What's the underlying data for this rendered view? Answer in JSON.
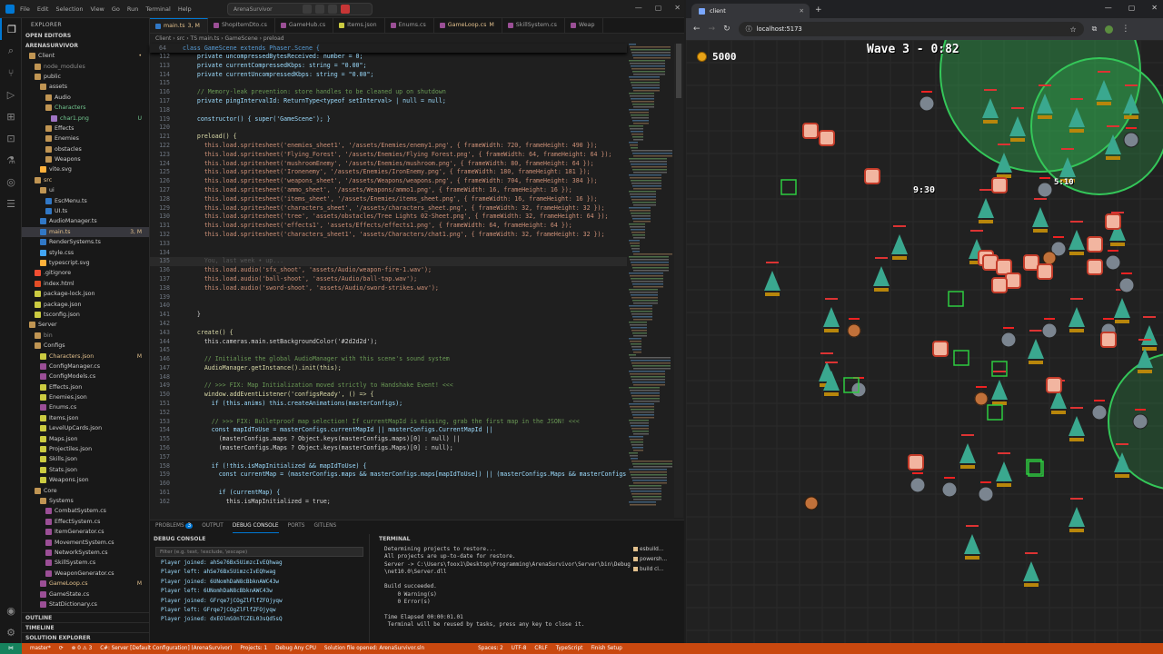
{
  "vscode": {
    "menu": [
      "File",
      "Edit",
      "Selection",
      "View",
      "Go",
      "Run",
      "Terminal",
      "Help"
    ],
    "search": "ArenaSurvivor",
    "explorer_title": "EXPLORER",
    "open_editors": "OPEN EDITORS",
    "workspace": "ARENASURVIVOR",
    "tree": [
      {
        "label": "Client",
        "indent": 1,
        "color": "#cccccc",
        "icon": "folder",
        "badge": "•",
        "bc": "#e2c08d"
      },
      {
        "label": "node_modules",
        "indent": 2,
        "color": "#8b8b8b",
        "icon": "folder"
      },
      {
        "label": "public",
        "indent": 2,
        "color": "#cccccc",
        "icon": "folder"
      },
      {
        "label": "assets",
        "indent": 3,
        "color": "#cccccc",
        "icon": "folder"
      },
      {
        "label": "Audio",
        "indent": 4,
        "color": "#cccccc",
        "icon": "folder"
      },
      {
        "label": "Characters",
        "indent": 4,
        "color": "#73c991",
        "icon": "folder"
      },
      {
        "label": "char1.png",
        "indent": 5,
        "color": "#73c991",
        "icon": "img",
        "badge": "U",
        "bc": "#73c991"
      },
      {
        "label": "Effects",
        "indent": 4,
        "color": "#cccccc",
        "icon": "folder"
      },
      {
        "label": "Enemies",
        "indent": 4,
        "color": "#cccccc",
        "icon": "folder"
      },
      {
        "label": "obstacles",
        "indent": 4,
        "color": "#cccccc",
        "icon": "folder"
      },
      {
        "label": "Weapons",
        "indent": 4,
        "color": "#cccccc",
        "icon": "folder"
      },
      {
        "label": "vite.svg",
        "indent": 3,
        "color": "#cccccc",
        "icon": "svg"
      },
      {
        "label": "src",
        "indent": 2,
        "color": "#e2c08d",
        "icon": "folder"
      },
      {
        "label": "ui",
        "indent": 3,
        "color": "#cccccc",
        "icon": "folder"
      },
      {
        "label": "EscMenu.ts",
        "indent": 4,
        "color": "#cccccc",
        "icon": "ts"
      },
      {
        "label": "UI.ts",
        "indent": 4,
        "color": "#cccccc",
        "icon": "ts"
      },
      {
        "label": "AudioManager.ts",
        "indent": 3,
        "color": "#cccccc",
        "icon": "ts"
      },
      {
        "label": "main.ts",
        "indent": 3,
        "color": "#e2c08d",
        "icon": "ts",
        "badge": "3, M",
        "bc": "#e2c08d",
        "sel": true
      },
      {
        "label": "RenderSystems.ts",
        "indent": 3,
        "color": "#cccccc",
        "icon": "ts"
      },
      {
        "label": "style.css",
        "indent": 3,
        "color": "#cccccc",
        "icon": "css"
      },
      {
        "label": "typescript.svg",
        "indent": 3,
        "color": "#cccccc",
        "icon": "svg"
      },
      {
        "label": ".gitignore",
        "indent": 2,
        "color": "#cccccc",
        "icon": "git"
      },
      {
        "label": "index.html",
        "indent": 2,
        "color": "#cccccc",
        "icon": "html"
      },
      {
        "label": "package-lock.json",
        "indent": 2,
        "color": "#cccccc",
        "icon": "json"
      },
      {
        "label": "package.json",
        "indent": 2,
        "color": "#cccccc",
        "icon": "json"
      },
      {
        "label": "tsconfig.json",
        "indent": 2,
        "color": "#cccccc",
        "icon": "json"
      },
      {
        "label": "Server",
        "indent": 1,
        "color": "#cccccc",
        "icon": "folder"
      },
      {
        "label": "bin",
        "indent": 2,
        "color": "#8b8b8b",
        "icon": "folder"
      },
      {
        "label": "Configs",
        "indent": 2,
        "color": "#cccccc",
        "icon": "folder"
      },
      {
        "label": "Characters.json",
        "indent": 3,
        "color": "#e2c08d",
        "icon": "json",
        "badge": "M",
        "bc": "#e2c08d"
      },
      {
        "label": "ConfigManager.cs",
        "indent": 3,
        "color": "#cccccc",
        "icon": "cs"
      },
      {
        "label": "ConfigModels.cs",
        "indent": 3,
        "color": "#cccccc",
        "icon": "cs"
      },
      {
        "label": "Effects.json",
        "indent": 3,
        "color": "#cccccc",
        "icon": "json"
      },
      {
        "label": "Enemies.json",
        "indent": 3,
        "color": "#cccccc",
        "icon": "json"
      },
      {
        "label": "Enums.cs",
        "indent": 3,
        "color": "#cccccc",
        "icon": "cs"
      },
      {
        "label": "Items.json",
        "indent": 3,
        "color": "#cccccc",
        "icon": "json"
      },
      {
        "label": "LevelUpCards.json",
        "indent": 3,
        "color": "#cccccc",
        "icon": "json"
      },
      {
        "label": "Maps.json",
        "indent": 3,
        "color": "#cccccc",
        "icon": "json"
      },
      {
        "label": "Projectiles.json",
        "indent": 3,
        "color": "#cccccc",
        "icon": "json"
      },
      {
        "label": "Skills.json",
        "indent": 3,
        "color": "#cccccc",
        "icon": "json"
      },
      {
        "label": "Stats.json",
        "indent": 3,
        "color": "#cccccc",
        "icon": "json"
      },
      {
        "label": "Weapons.json",
        "indent": 3,
        "color": "#cccccc",
        "icon": "json"
      },
      {
        "label": "Core",
        "indent": 2,
        "color": "#cccccc",
        "icon": "folder"
      },
      {
        "label": "Systems",
        "indent": 3,
        "color": "#cccccc",
        "icon": "folder"
      },
      {
        "label": "CombatSystem.cs",
        "indent": 4,
        "color": "#cccccc",
        "icon": "cs"
      },
      {
        "label": "EffectSystem.cs",
        "indent": 4,
        "color": "#cccccc",
        "icon": "cs"
      },
      {
        "label": "ItemGenerator.cs",
        "indent": 4,
        "color": "#cccccc",
        "icon": "cs"
      },
      {
        "label": "MovementSystem.cs",
        "indent": 4,
        "color": "#cccccc",
        "icon": "cs"
      },
      {
        "label": "NetworkSystem.cs",
        "indent": 4,
        "color": "#cccccc",
        "icon": "cs"
      },
      {
        "label": "SkillSystem.cs",
        "indent": 4,
        "color": "#cccccc",
        "icon": "cs"
      },
      {
        "label": "WeaponGenerator.cs",
        "indent": 4,
        "color": "#cccccc",
        "icon": "cs"
      },
      {
        "label": "GameLoop.cs",
        "indent": 3,
        "color": "#e2c08d",
        "icon": "cs",
        "badge": "M",
        "bc": "#e2c08d"
      },
      {
        "label": "GameState.cs",
        "indent": 3,
        "color": "#cccccc",
        "icon": "cs"
      },
      {
        "label": "StatDictionary.cs",
        "indent": 3,
        "color": "#cccccc",
        "icon": "cs"
      }
    ],
    "outline": "OUTLINE",
    "timeline": "TIMELINE",
    "solution_explorer": "SOLUTION EXPLORER",
    "tabs": [
      {
        "label": "main.ts",
        "suffix": "3, M",
        "active": true,
        "color": "#e2c08d",
        "icon": "#3178c6"
      },
      {
        "label": "ShopItemDto.cs",
        "icon": "#9b4f96"
      },
      {
        "label": "GameHub.cs",
        "icon": "#9b4f96"
      },
      {
        "label": "Items.json",
        "icon": "#cbcb41"
      },
      {
        "label": "Enums.cs",
        "icon": "#9b4f96"
      },
      {
        "label": "GameLoop.cs",
        "suffix": "M",
        "color": "#e2c08d",
        "icon": "#9b4f96"
      },
      {
        "label": "SkillSystem.cs",
        "icon": "#9b4f96"
      },
      {
        "label": "Weap",
        "icon": "#9b4f96"
      }
    ],
    "breadcrumb": "Client › src › TS main.ts › GameScene › preload",
    "sticky": {
      "num": "64",
      "text": "class GameScene extends Phaser.Scene {"
    },
    "code": [
      [
        "112",
        "    private uncompressedBytesReceived: number = 0;"
      ],
      [
        "113",
        "    private currentCompressedKbps: string = \"0.00\";"
      ],
      [
        "114",
        "    private currentUncompressedKbps: string = \"0.00\";"
      ],
      [
        "115",
        ""
      ],
      [
        "116",
        "    // Memory-leak prevention: store handles to be cleaned up on shutdown"
      ],
      [
        "117",
        "    private pingIntervalId: ReturnType<typeof setInterval> | null = null;"
      ],
      [
        "118",
        ""
      ],
      [
        "119",
        "    constructor() { super('GameScene'); }"
      ],
      [
        "120",
        ""
      ],
      [
        "121",
        "    preload() {"
      ],
      [
        "122",
        "      this.load.spritesheet('enemies_sheet1', '/assets/Enemies/enemy1.png', { frameWidth: 720, frameHeight: 490 });"
      ],
      [
        "123",
        "      this.load.spritesheet('Flying_Forest', '/assets/Enemies/Flying Forest.png', { frameWidth: 64, frameHeight: 64 });"
      ],
      [
        "124",
        "      this.load.spritesheet('mushroomEnemy', '/assets/Enemies/mushroom.png', { frameWidth: 80, frameHeight: 64 });"
      ],
      [
        "125",
        "      this.load.spritesheet('Ironenemy', '/assets/Enemies/IronEnemy.png', { frameWidth: 180, frameHeight: 181 });"
      ],
      [
        "126",
        "      this.load.spritesheet('weapons_sheet', '/assets/Weapons/weapons.png', { frameWidth: 704, frameHeight: 384 });"
      ],
      [
        "127",
        "      this.load.spritesheet('ammo_sheet', '/assets/Weapons/ammo1.png', { frameWidth: 16, frameHeight: 16 });"
      ],
      [
        "128",
        "      this.load.spritesheet('items_sheet', '/assets/Enemies/items_sheet.png', { frameWidth: 16, frameHeight: 16 });"
      ],
      [
        "129",
        "      this.load.spritesheet('characters_sheet', '/assets/characters_sheet.png', { frameWidth: 32, frameHeight: 32 });"
      ],
      [
        "130",
        "      this.load.spritesheet('tree', 'assets/obstacles/Tree Lights 02-Sheet.png', { frameWidth: 32, frameHeight: 64 });"
      ],
      [
        "131",
        "      this.load.spritesheet('effects1', 'assets/Effects/effects1.png', { frameWidth: 64, frameHeight: 64 });"
      ],
      [
        "132",
        "      this.load.spritesheet('characters_sheet1', 'assets/Characters/chat1.png', { frameWidth: 32, frameHeight: 32 });"
      ],
      [
        "133",
        ""
      ],
      [
        "134",
        ""
      ],
      [
        "135",
        "      You, last week • up..."
      ],
      [
        "136",
        "      this.load.audio('sfx_shoot', 'assets/Audio/weapon-fire-1.wav');"
      ],
      [
        "137",
        "      this.load.audio('ball-shoot', 'assets/Audio/ball-tap.wav');"
      ],
      [
        "138",
        "      this.load.audio('sword-shoot', 'assets/Audio/sword-strikes.wav');"
      ],
      [
        "139",
        ""
      ],
      [
        "140",
        ""
      ],
      [
        "141",
        "    }"
      ],
      [
        "142",
        ""
      ],
      [
        "143",
        "    create() {"
      ],
      [
        "144",
        "      this.cameras.main.setBackgroundColor('#2d2d2d');"
      ],
      [
        "145",
        ""
      ],
      [
        "146",
        "      // Initialise the global AudioManager with this scene's sound system"
      ],
      [
        "147",
        "      AudioManager.getInstance().init(this);"
      ],
      [
        "148",
        ""
      ],
      [
        "149",
        "      // >>> FIX: Map Initialization moved strictly to Handshake Event! <<<"
      ],
      [
        "150",
        "      window.addEventListener('configsReady', () => {"
      ],
      [
        "151",
        "        if (this.anims) this.createAnimations(masterConfigs);"
      ],
      [
        "152",
        ""
      ],
      [
        "153",
        "        // >>> FIX: Bulletproof map selection! If currentMapId is missing, grab the first map in the JSON! <<<"
      ],
      [
        "154",
        "        const mapIdToUse = masterConfigs.currentMapId || masterConfigs.CurrentMapId ||"
      ],
      [
        "155",
        "          (masterConfigs.maps ? Object.keys(masterConfigs.maps)[0] : null) ||"
      ],
      [
        "156",
        "          (masterConfigs.Maps ? Object.keys(masterConfigs.Maps)[0] : null);"
      ],
      [
        "157",
        ""
      ],
      [
        "158",
        "        if (!this.isMapInitialized && mapIdToUse) {"
      ],
      [
        "159",
        "          const currentMap = (masterConfigs.maps && masterConfigs.maps[mapIdToUse]) || (masterConfigs.Maps && masterConfigs.Maps[m"
      ],
      [
        "160",
        ""
      ],
      [
        "161",
        "          if (currentMap) {"
      ],
      [
        "162",
        "            this.isMapInitialized = true;"
      ]
    ],
    "panel_tabs": {
      "problems": "PROBLEMS",
      "problems_count": "3",
      "output": "OUTPUT",
      "debug_console": "DEBUG CONSOLE",
      "ports": "PORTS",
      "gitlens": "GITLENS"
    },
    "debug": {
      "title": "DEBUG CONSOLE",
      "filter_placeholder": "Filter (e.g. text, !exclude, \\escape)",
      "lines": [
        "Player joined: ahSe76Bx5UimzcIvEQhwag",
        "Player left: ahSe76Bx5UimzcIvEQhwag",
        "Player joined: 6UNomhDaN8cBbknAWC43w",
        "Player left: 6UNomhDaN8cBbknAWC43w",
        "Player joined: GFrqe7jCOgZlFlfZFOjyqw",
        "Player left: GFrqe7jCOgZlFlfZFOjyqw",
        "Player joined: dxEOlmSOnTCZEL03sQd5sQ"
      ]
    },
    "terminal": {
      "title": "TERMINAL",
      "lines": [
        "Determining projects to restore...",
        "All projects are up-to-date for restore.",
        "Server -> C:\\Users\\foox1\\Desktop\\Programming\\ArenaSurvivor\\Server\\bin\\Debug",
        "\\net10.0\\Server.dll",
        "",
        "Build succeeded.",
        "    0 Warning(s)",
        "    0 Error(s)",
        "",
        "Time Elapsed 00:00:01.01",
        " Terminal will be reused by tasks, press any key to close it."
      ],
      "sessions": [
        "esbuild...",
        "powersh...",
        "build cl..."
      ]
    },
    "status": {
      "branch": "master*",
      "sync": "⟳",
      "errors": "⊗ 0 ⚠ 3",
      "config": "C#: Server [Default Configuration] (ArenaSurvivor)",
      "projects": "Projects: 1",
      "debug": "Debug Any CPU",
      "solution": "Solution file opened: ArenaSurvivor.sln",
      "spaces": "Spaces: 2",
      "encoding": "UTF-8",
      "eol": "CRLF",
      "lang": "TypeScript",
      "finish": "Finish Setup"
    }
  },
  "browser": {
    "tab_title": "client",
    "url": "localhost:5173",
    "hud": {
      "gold": "5000",
      "wave": "Wave 3 - 0:82"
    },
    "tags": {
      "score": "9:30",
      "damage": "5:10"
    }
  },
  "colors": {
    "status_bar": "#c9480f",
    "accent": "#0078d4",
    "modified": "#e2c08d",
    "untracked": "#73c991",
    "game_bg": "#212121",
    "aura": "#34c759"
  }
}
